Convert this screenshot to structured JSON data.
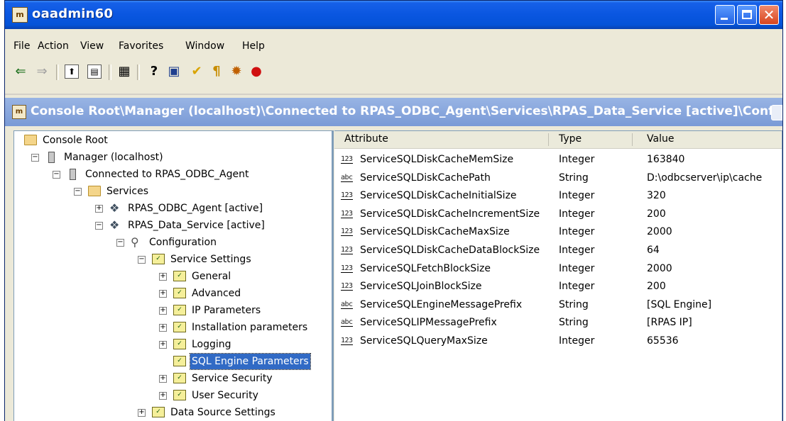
{
  "window": {
    "title": "oaadmin60",
    "app_icon": "mmc-console-icon",
    "close_glyph": "✕"
  },
  "menu": [
    "File",
    "Action",
    "View",
    "Favorites",
    "Window",
    "Help"
  ],
  "toolbar": [
    {
      "icon": "back-arrow-icon",
      "glyph": "⇐"
    },
    {
      "icon": "forward-arrow-icon",
      "glyph": "⇒"
    },
    {
      "icon": "up-folder-icon",
      "glyph": "⬆"
    },
    {
      "icon": "show-hide-tree-icon",
      "glyph": "▤"
    },
    {
      "icon": "export-list-icon",
      "glyph": "▦"
    },
    {
      "icon": "help-icon",
      "glyph": "?"
    },
    {
      "icon": "properties-icon",
      "glyph": "▣"
    },
    {
      "icon": "checkmark-icon",
      "glyph": "✔"
    },
    {
      "icon": "connect-icon",
      "glyph": "¶"
    },
    {
      "icon": "service-gear-icon",
      "glyph": "✹"
    },
    {
      "icon": "traffic-light-icon",
      "glyph": "●"
    }
  ],
  "child_window": {
    "title": "Console Root\\Manager (localhost)\\Connected to RPAS_ODBC_Agent\\Services\\RPAS_Data_Service [active]\\Conf..."
  },
  "tree": [
    {
      "label": "Console Root",
      "icon": "folder-icon",
      "level": 0,
      "expander": ""
    },
    {
      "label": "Manager (localhost)",
      "icon": "server-icon",
      "level": 1,
      "expander": "−"
    },
    {
      "label": "Connected to RPAS_ODBC_Agent",
      "icon": "server-icon",
      "level": 2,
      "expander": "−"
    },
    {
      "label": "Services",
      "icon": "folder-icon",
      "level": 3,
      "expander": "−"
    },
    {
      "label": "RPAS_ODBC_Agent [active]",
      "icon": "service-icon",
      "level": 4,
      "expander": "+"
    },
    {
      "label": "RPAS_Data_Service [active]",
      "icon": "service-icon",
      "level": 4,
      "expander": "−"
    },
    {
      "label": "Configuration",
      "icon": "config-icon",
      "level": 5,
      "expander": "−"
    },
    {
      "label": "Service Settings",
      "icon": "settings-icon",
      "level": 6,
      "expander": "−"
    },
    {
      "label": "General",
      "icon": "settings-icon",
      "level": 7,
      "expander": "+"
    },
    {
      "label": "Advanced",
      "icon": "settings-icon",
      "level": 7,
      "expander": "+"
    },
    {
      "label": "IP Parameters",
      "icon": "settings-icon",
      "level": 7,
      "expander": "+"
    },
    {
      "label": "Installation parameters",
      "icon": "settings-icon",
      "level": 7,
      "expander": "+"
    },
    {
      "label": "Logging",
      "icon": "settings-icon",
      "level": 7,
      "expander": "+"
    },
    {
      "label": "SQL Engine Parameters",
      "icon": "settings-icon",
      "level": 7,
      "expander": "",
      "selected": true
    },
    {
      "label": "Service Security",
      "icon": "settings-icon",
      "level": 7,
      "expander": "+"
    },
    {
      "label": "User Security",
      "icon": "settings-icon",
      "level": 7,
      "expander": "+"
    },
    {
      "label": "Data Source Settings",
      "icon": "settings-icon",
      "level": 6,
      "expander": "+"
    }
  ],
  "list": {
    "columns": [
      "Attribute",
      "Type",
      "Value"
    ],
    "rows": [
      {
        "type_icon": "123",
        "attribute": "ServiceSQLDiskCacheMemSize",
        "type": "Integer",
        "value": "163840"
      },
      {
        "type_icon": "abc",
        "attribute": "ServiceSQLDiskCachePath",
        "type": "String",
        "value": "D:\\odbcserver\\ip\\cache"
      },
      {
        "type_icon": "123",
        "attribute": "ServiceSQLDiskCacheInitialSize",
        "type": "Integer",
        "value": "320"
      },
      {
        "type_icon": "123",
        "attribute": "ServiceSQLDiskCacheIncrementSize",
        "type": "Integer",
        "value": "200"
      },
      {
        "type_icon": "123",
        "attribute": "ServiceSQLDiskCacheMaxSize",
        "type": "Integer",
        "value": "2000"
      },
      {
        "type_icon": "123",
        "attribute": "ServiceSQLDiskCacheDataBlockSize",
        "type": "Integer",
        "value": "64"
      },
      {
        "type_icon": "123",
        "attribute": "ServiceSQLFetchBlockSize",
        "type": "Integer",
        "value": "2000"
      },
      {
        "type_icon": "123",
        "attribute": "ServiceSQLJoinBlockSize",
        "type": "Integer",
        "value": "200"
      },
      {
        "type_icon": "abc",
        "attribute": "ServiceSQLEngineMessagePrefix",
        "type": "String",
        "value": "[SQL Engine]"
      },
      {
        "type_icon": "abc",
        "attribute": "ServiceSQLIPMessagePrefix",
        "type": "String",
        "value": "[RPAS IP]"
      },
      {
        "type_icon": "123",
        "attribute": "ServiceSQLQueryMaxSize",
        "type": "Integer",
        "value": "65536"
      }
    ]
  }
}
